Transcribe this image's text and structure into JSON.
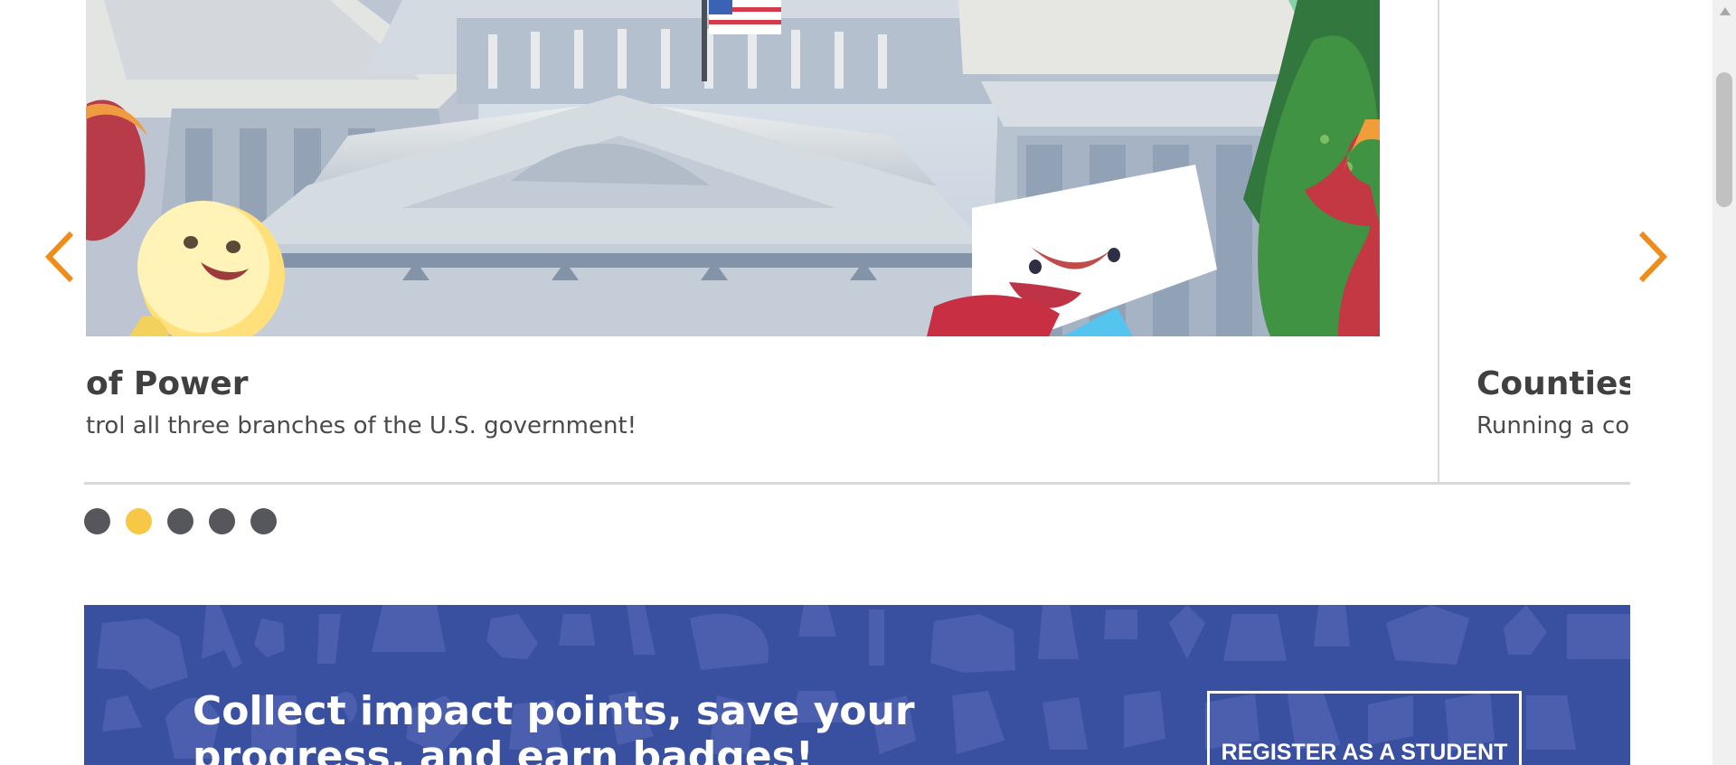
{
  "carousel": {
    "current_slide": {
      "title": "of Power",
      "description": "trol all three branches of the U.S. government!",
      "image_icon": "capitol-building-illustration"
    },
    "next_slide": {
      "title": "Counties W",
      "description": "Running a co"
    },
    "arrows": {
      "previous_icon": "chevron-left-icon",
      "next_icon": "chevron-right-icon",
      "color": "#ef8d1c"
    },
    "pagination": {
      "count": 5,
      "active_index": 1,
      "active_color": "#f7c846",
      "inactive_color": "#55575d"
    }
  },
  "banner": {
    "headline": "Collect impact points, save your progress, and earn badges!",
    "register_button": "REGISTER AS A STUDENT",
    "background_color": "#394fa0"
  },
  "scrollbar": {
    "thumb_icon": "scrollbar-thumb"
  }
}
